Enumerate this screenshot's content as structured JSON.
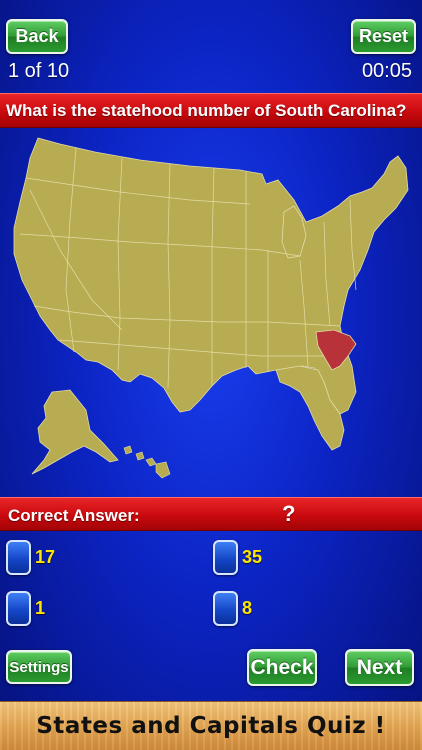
{
  "header": {
    "back_label": "Back",
    "reset_label": "Reset",
    "progress": "1 of 10",
    "timer": "00:05"
  },
  "question": {
    "text": "What is the statehood number of South Carolina?",
    "highlighted_state": "South Carolina"
  },
  "answer": {
    "label": "Correct Answer:",
    "value": "?"
  },
  "options": [
    {
      "label": "17"
    },
    {
      "label": "35"
    },
    {
      "label": "1"
    },
    {
      "label": "8"
    }
  ],
  "controls": {
    "settings_label": "Settings",
    "check_label": "Check",
    "next_label": "Next"
  },
  "footer": {
    "title": "States and Capitals Quiz !"
  },
  "colors": {
    "background": "#0c24c4",
    "map_fill": "#b8ac52",
    "highlight": "#b8323a",
    "banner_red": "#c8090d",
    "button_green": "#2f9a34",
    "option_text": "#ffe600"
  },
  "icons": {
    "option_marker": "rounded-blue-checkbox-icon"
  }
}
